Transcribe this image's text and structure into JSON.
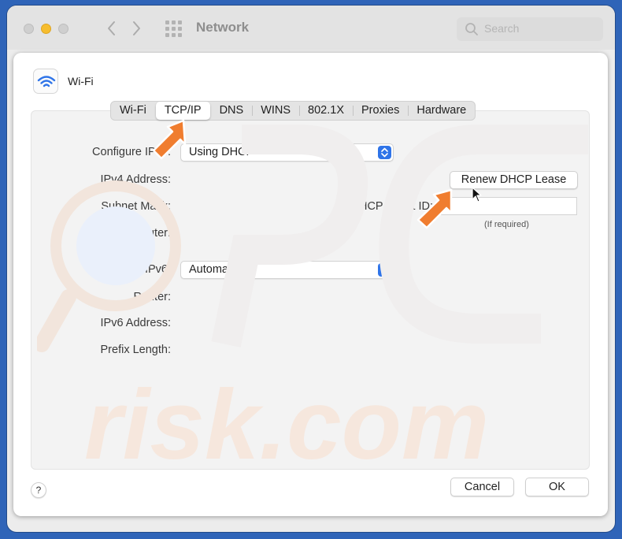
{
  "window": {
    "title": "Network"
  },
  "search": {
    "placeholder": "Search"
  },
  "service": {
    "name": "Wi-Fi",
    "icon": "wifi-icon"
  },
  "tabs": [
    {
      "label": "Wi-Fi"
    },
    {
      "label": "TCP/IP",
      "active": true
    },
    {
      "label": "DNS"
    },
    {
      "label": "WINS"
    },
    {
      "label": "802.1X"
    },
    {
      "label": "Proxies"
    },
    {
      "label": "Hardware"
    }
  ],
  "ipv4": {
    "configure_label": "Configure IPv4:",
    "configure_value": "Using DHCP",
    "address_label": "IPv4 Address:",
    "subnet_label": "Subnet Mask:",
    "router_label": "Router:",
    "renew_button": "Renew DHCP Lease",
    "client_id_label": "DHCP Client ID:",
    "client_id_value": "",
    "client_id_hint": "(If required)"
  },
  "ipv6": {
    "configure_label": "Configure IPv6:",
    "configure_value": "Automatically",
    "router_label": "Router:",
    "address_label": "IPv6 Address:",
    "prefix_label": "Prefix Length:"
  },
  "buttons": {
    "help": "?",
    "cancel": "Cancel",
    "ok": "OK"
  },
  "colors": {
    "accent": "#2f74e8",
    "annotation_arrow": "#f07d2f",
    "watermark": "#f7ddcc"
  }
}
